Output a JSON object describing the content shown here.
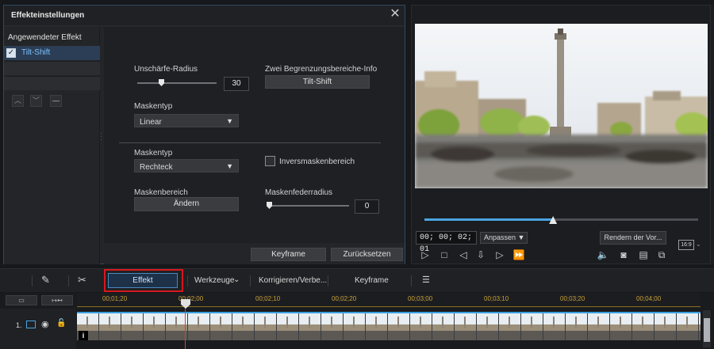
{
  "effect_panel": {
    "title": "Effekteinstellungen",
    "close_label": "✕",
    "applied_effects_title": "Angewendeter Effekt",
    "applied_effects": [
      {
        "label": "Tilt-Shift",
        "checked": true
      }
    ],
    "settings": {
      "blur_radius_label": "Unschärfe-Radius",
      "blur_radius_value": "30",
      "blur_radius_level": 0.3,
      "two_boundaries_label": "Zwei Begrenzungsbereiche-Info",
      "two_boundaries_button": "Tilt-Shift",
      "mask_type_label_1": "Maskentyp",
      "mask_type_value_1": "Linear",
      "mask_type_label_2": "Maskentyp",
      "mask_type_value_2": "Rechteck",
      "invert_mask_label": "Inversmaskenbereich",
      "mask_area_label": "Maskenbereich",
      "mask_area_button": "Ändern",
      "feather_radius_label": "Maskenfederradius",
      "feather_radius_value": "0",
      "feather_radius_level": 0.0
    },
    "footer": {
      "keyframe_button": "Keyframe",
      "reset_button": "Zurücksetzen"
    }
  },
  "preview": {
    "scrub_progress": 0.47,
    "timecode": "00; 00; 02; 01",
    "fit_label": "Anpassen ▼",
    "render_label": "Rendern der Vor...",
    "aspect_label": "16:9"
  },
  "toolbar": {
    "effect_button": "Effekt",
    "tools_label": "Werkzeuge",
    "correct_label": "Korrigieren/Verbe...",
    "keyframe_label": "Keyframe"
  },
  "timeline": {
    "ruler_labels": [
      "00;01;20",
      "00;02;00",
      "00;02;10",
      "00;02;20",
      "00;03;00",
      "00;03;10",
      "00;03;20",
      "00;04;00"
    ],
    "track_label": "1.",
    "clip_info": "i"
  },
  "colors": {
    "accent": "#4ba3e0",
    "highlight": "#d6181f",
    "timecode": "#c7a23a"
  }
}
